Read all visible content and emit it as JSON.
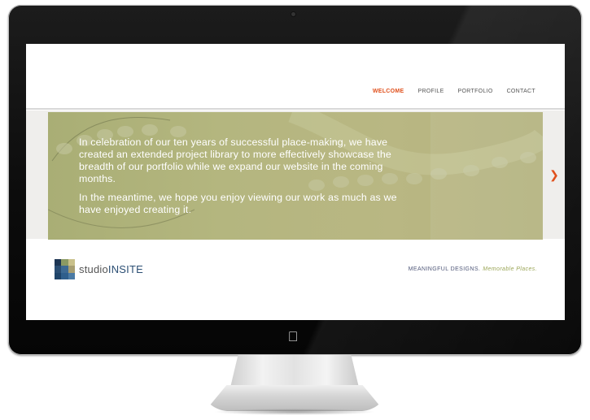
{
  "nav": {
    "items": [
      {
        "label": "WELCOME",
        "active": true
      },
      {
        "label": "PROFILE",
        "active": false
      },
      {
        "label": "PORTFOLIO",
        "active": false
      },
      {
        "label": "CONTACT",
        "active": false
      }
    ]
  },
  "slide": {
    "paragraph1": "In celebration of our ten years of successful place-making, we have created an extended project library to more effectively showcase the breadth of our portfolio while we expand our website in the coming months.",
    "paragraph2": "In the meantime, we hope you enjoy viewing our work as much as we have enjoyed creating it.",
    "next_icon": "chevron-right-icon"
  },
  "footer": {
    "logo_light": "studio",
    "logo_bold": "INSITE",
    "tagline_main": "MEANINGFUL DESIGNS.",
    "tagline_accent": "Memorable Places."
  },
  "colors": {
    "accent": "#e0501c",
    "slide_bg": "#b4b67f",
    "brand_blue": "#2c4f74",
    "tagline_green": "#9aa556"
  }
}
